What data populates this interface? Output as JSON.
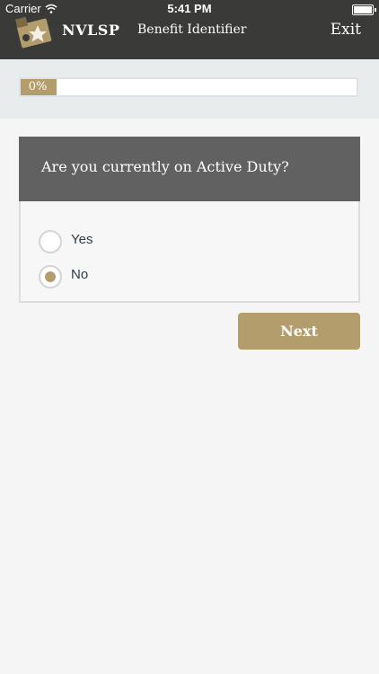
{
  "status_bar": {
    "carrier": "Carrier",
    "time": "5:41 PM"
  },
  "nav": {
    "brand": "NVLSP",
    "title": "Benefit Identifier",
    "exit_label": "Exit"
  },
  "progress": {
    "label": "0%",
    "value": 0
  },
  "question": {
    "text": "Are you currently on Active Duty?",
    "options": [
      {
        "label": "Yes",
        "selected": false
      },
      {
        "label": "No",
        "selected": true
      }
    ]
  },
  "actions": {
    "next_label": "Next"
  },
  "colors": {
    "accent": "#b39d6c",
    "header_bg": "#3a3a38",
    "question_bg": "#616161"
  }
}
